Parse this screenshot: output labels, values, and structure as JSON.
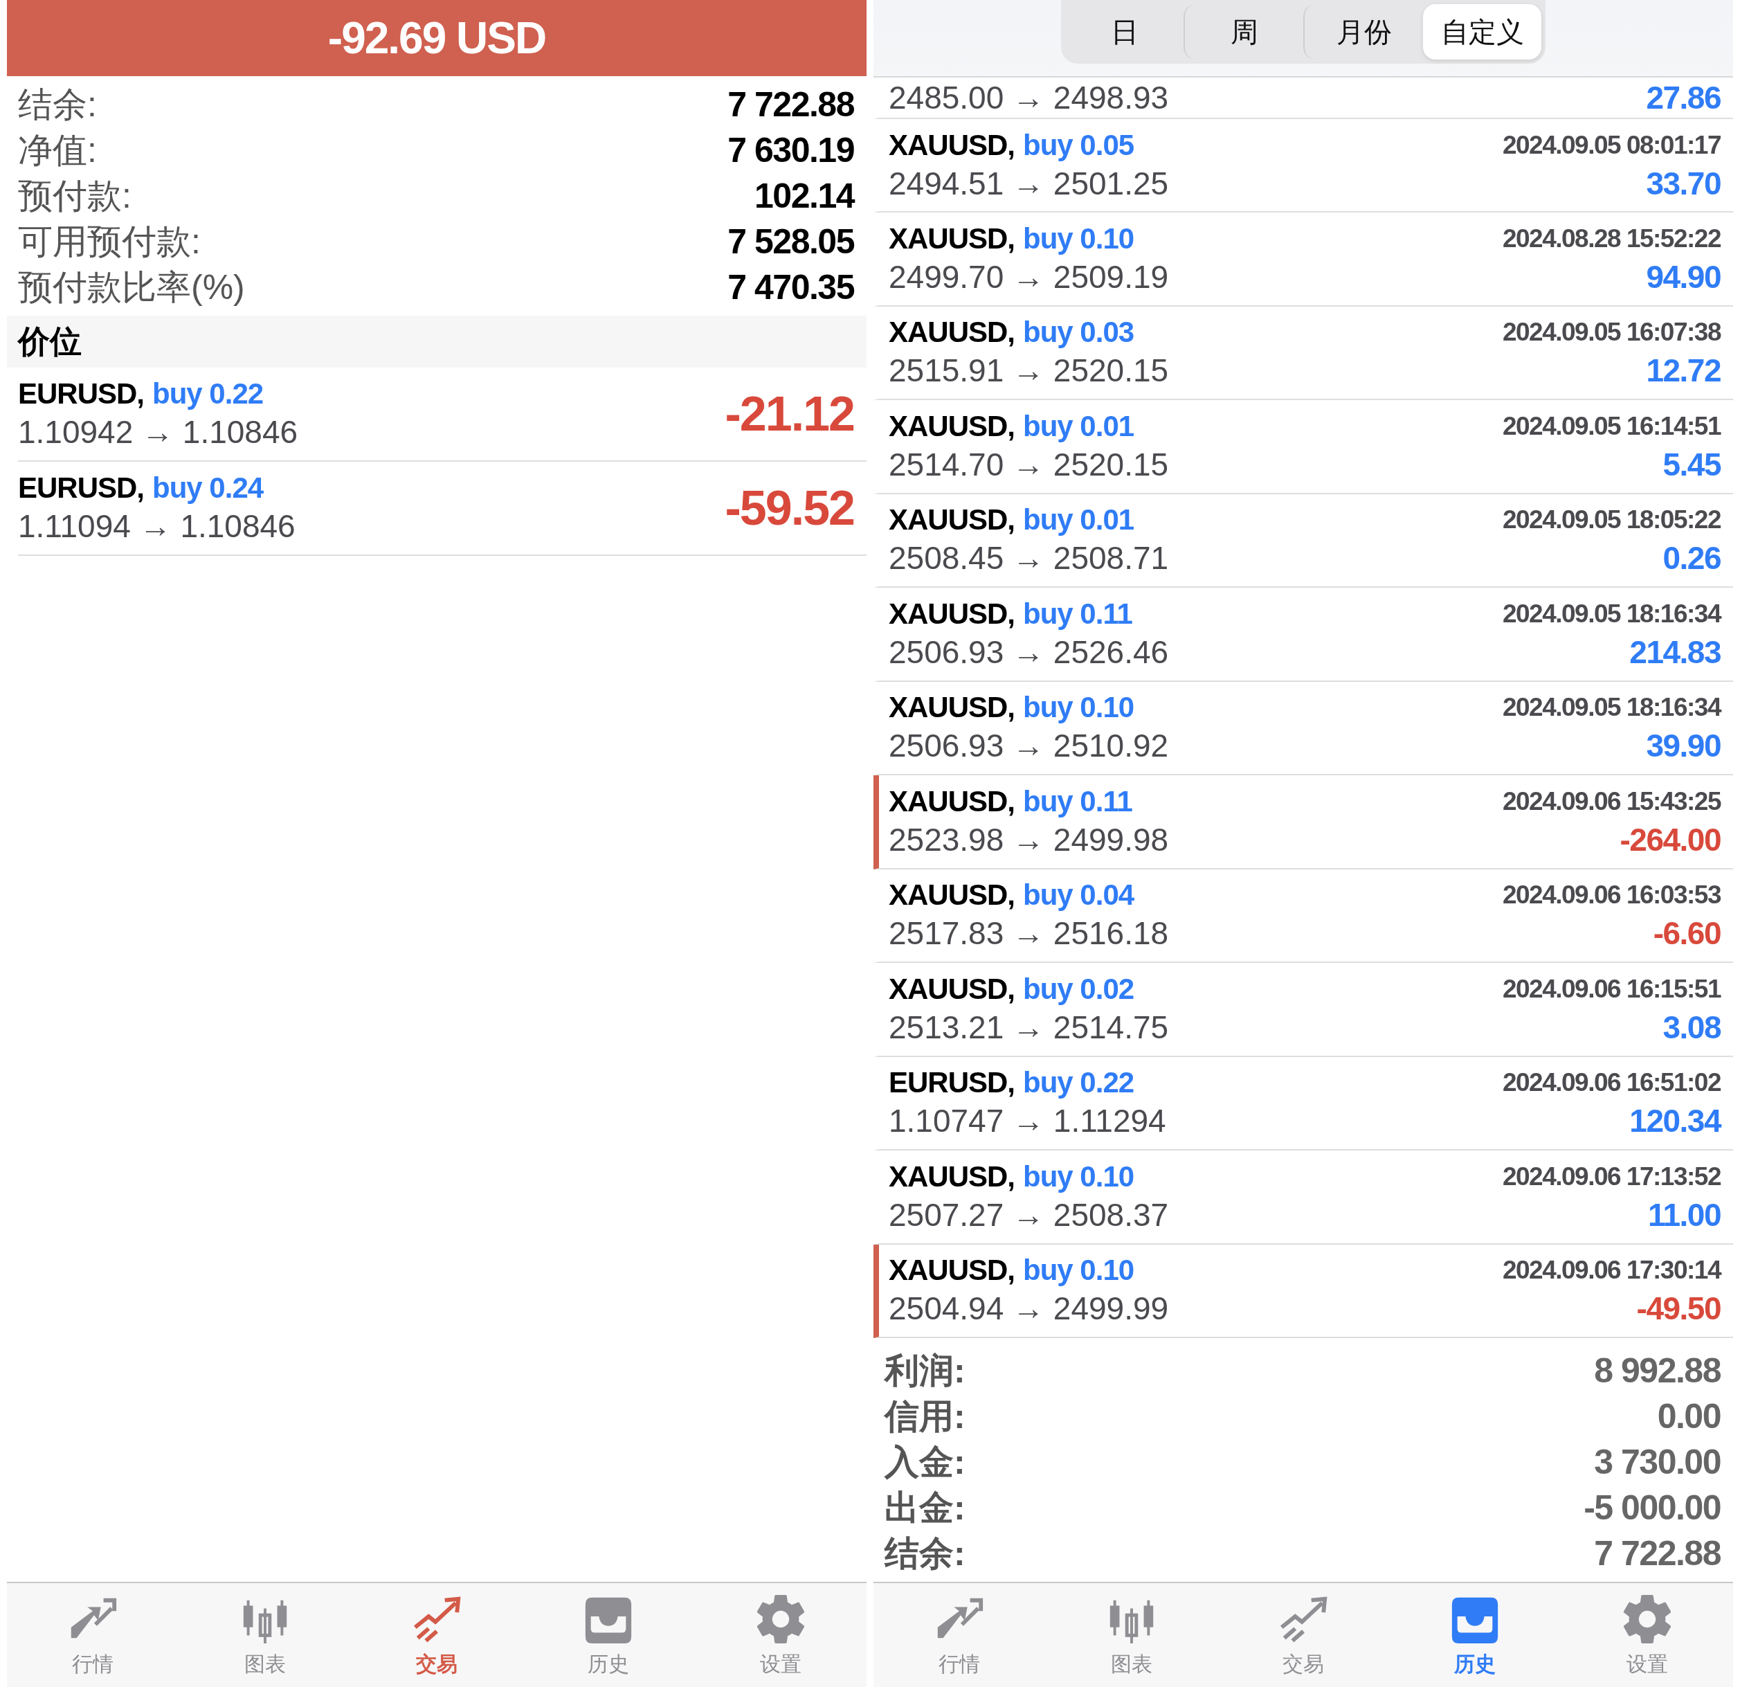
{
  "trade_screen": {
    "header": {
      "amount": "-92.69 USD"
    },
    "account": [
      {
        "label": "结余:",
        "value": "7 722.88"
      },
      {
        "label": "净值:",
        "value": "7 630.19"
      },
      {
        "label": "预付款:",
        "value": "102.14"
      },
      {
        "label": "可用预付款:",
        "value": "7 528.05"
      },
      {
        "label": "预付款比率(%)",
        "value": "7 470.35"
      }
    ],
    "section_title": "价位",
    "positions": [
      {
        "symbol": "EURUSD,",
        "side": "buy 0.22",
        "prices": "1.10942 → 1.10846",
        "profit": "-21.12",
        "color": "#d8493b"
      },
      {
        "symbol": "EURUSD,",
        "side": "buy 0.24",
        "prices": "1.11094 → 1.10846",
        "profit": "-59.52",
        "color": "#d8493b"
      }
    ],
    "tab_bar": [
      {
        "kind": "quotes",
        "label": "行情",
        "selected": false,
        "color": "#8e8e93"
      },
      {
        "kind": "chart",
        "label": "图表",
        "selected": false,
        "color": "#8e8e93"
      },
      {
        "kind": "trade",
        "label": "交易",
        "selected": true,
        "color": "#d45a48"
      },
      {
        "kind": "history",
        "label": "历史",
        "selected": false,
        "color": "#8e8e93"
      },
      {
        "kind": "settings",
        "label": "设置",
        "selected": false,
        "color": "#8e8e93"
      }
    ]
  },
  "history_screen": {
    "periods": [
      {
        "label": "日",
        "selected": false
      },
      {
        "label": "周",
        "selected": false
      },
      {
        "label": "月份",
        "selected": false
      },
      {
        "label": "自定义",
        "selected": true
      }
    ],
    "rows": [
      {
        "prices": "2485.00 → 2498.93",
        "profit": "27.86",
        "color": "#2f7cf6",
        "flagged": false
      },
      {
        "symbol": "XAUUSD,",
        "side": "buy 0.05",
        "time": "2024.09.05 08:01:17",
        "prices": "2494.51 → 2501.25",
        "profit": "33.70",
        "color": "#2f7cf6",
        "flagged": false
      },
      {
        "symbol": "XAUUSD,",
        "side": "buy 0.10",
        "time": "2024.08.28 15:52:22",
        "prices": "2499.70 → 2509.19",
        "profit": "94.90",
        "color": "#2f7cf6",
        "flagged": false
      },
      {
        "symbol": "XAUUSD,",
        "side": "buy 0.03",
        "time": "2024.09.05 16:07:38",
        "prices": "2515.91 → 2520.15",
        "profit": "12.72",
        "color": "#2f7cf6",
        "flagged": false
      },
      {
        "symbol": "XAUUSD,",
        "side": "buy 0.01",
        "time": "2024.09.05 16:14:51",
        "prices": "2514.70 → 2520.15",
        "profit": "5.45",
        "color": "#2f7cf6",
        "flagged": false
      },
      {
        "symbol": "XAUUSD,",
        "side": "buy 0.01",
        "time": "2024.09.05 18:05:22",
        "prices": "2508.45 → 2508.71",
        "profit": "0.26",
        "color": "#2f7cf6",
        "flagged": false
      },
      {
        "symbol": "XAUUSD,",
        "side": "buy 0.11",
        "time": "2024.09.05 18:16:34",
        "prices": "2506.93 → 2526.46",
        "profit": "214.83",
        "color": "#2f7cf6",
        "flagged": false
      },
      {
        "symbol": "XAUUSD,",
        "side": "buy 0.10",
        "time": "2024.09.05 18:16:34",
        "prices": "2506.93 → 2510.92",
        "profit": "39.90",
        "color": "#2f7cf6",
        "flagged": false
      },
      {
        "symbol": "XAUUSD,",
        "side": "buy 0.11",
        "time": "2024.09.06 15:43:25",
        "prices": "2523.98 → 2499.98",
        "profit": "-264.00",
        "color": "#d8493b",
        "flagged": true
      },
      {
        "symbol": "XAUUSD,",
        "side": "buy 0.04",
        "time": "2024.09.06 16:03:53",
        "prices": "2517.83 → 2516.18",
        "profit": "-6.60",
        "color": "#d8493b",
        "flagged": false
      },
      {
        "symbol": "XAUUSD,",
        "side": "buy 0.02",
        "time": "2024.09.06 16:15:51",
        "prices": "2513.21 → 2514.75",
        "profit": "3.08",
        "color": "#2f7cf6",
        "flagged": false
      },
      {
        "symbol": "EURUSD,",
        "side": "buy 0.22",
        "time": "2024.09.06 16:51:02",
        "prices": "1.10747 → 1.11294",
        "profit": "120.34",
        "color": "#2f7cf6",
        "flagged": false
      },
      {
        "symbol": "XAUUSD,",
        "side": "buy 0.10",
        "time": "2024.09.06 17:13:52",
        "prices": "2507.27 → 2508.37",
        "profit": "11.00",
        "color": "#2f7cf6",
        "flagged": false
      },
      {
        "symbol": "XAUUSD,",
        "side": "buy 0.10",
        "time": "2024.09.06 17:30:14",
        "prices": "2504.94 → 2499.99",
        "profit": "-49.50",
        "color": "#d8493b",
        "flagged": true
      }
    ],
    "summary": [
      {
        "label": "利润:",
        "value": "8 992.88"
      },
      {
        "label": "信用:",
        "value": "0.00"
      },
      {
        "label": "入金:",
        "value": "3 730.00"
      },
      {
        "label": "出金:",
        "value": "-5 000.00"
      },
      {
        "label": "结余:",
        "value": "7 722.88"
      }
    ],
    "tab_bar": [
      {
        "kind": "quotes",
        "label": "行情",
        "selected": false,
        "color": "#8e8e93"
      },
      {
        "kind": "chart",
        "label": "图表",
        "selected": false,
        "color": "#8e8e93"
      },
      {
        "kind": "trade",
        "label": "交易",
        "selected": false,
        "color": "#8e8e93"
      },
      {
        "kind": "history",
        "label": "历史",
        "selected": true,
        "color": "#2f7cf6"
      },
      {
        "kind": "settings",
        "label": "设置",
        "selected": false,
        "color": "#8e8e93"
      }
    ]
  }
}
